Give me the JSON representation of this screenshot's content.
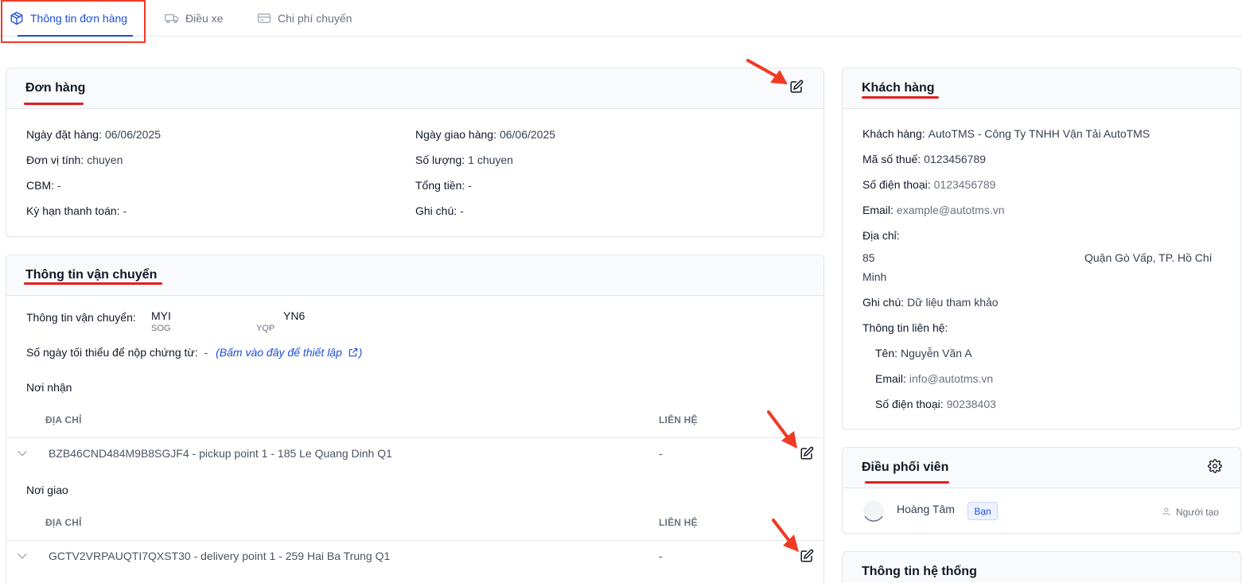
{
  "tabs": [
    {
      "label": "Thông tin đơn hàng",
      "icon": "box-icon",
      "active": true
    },
    {
      "label": "Điều xe",
      "icon": "truck-icon",
      "active": false
    },
    {
      "label": "Chi phí chuyến",
      "icon": "card-icon",
      "active": false
    }
  ],
  "order": {
    "title": "Đơn hàng",
    "order_date_label": "Ngày đặt hàng:",
    "order_date": "06/06/2025",
    "delivery_date_label": "Ngày giao hàng:",
    "delivery_date": "06/06/2025",
    "unit_label": "Đơn vị tính:",
    "unit": "chuyen",
    "quantity_label": "Số lượng:",
    "quantity": "1 chuyen",
    "cbm_label": "CBM:",
    "cbm": "-",
    "total_label": "Tổng tiền:",
    "total": "-",
    "payment_term_label": "Kỳ hạn thanh toán:",
    "payment_term": "-",
    "note_label": "Ghi chú:",
    "note": "-"
  },
  "shipping": {
    "title": "Thông tin vận chuyển",
    "info_label": "Thông tin vận chuyển:",
    "route_from_code": "MYI",
    "route_from_sub": "SOG",
    "route_to_code": "YN6",
    "route_to_sub": "YQP",
    "min_days_label": "Số ngày tối thiểu để nộp chứng từ:",
    "min_days_value": "-",
    "setup_link": "(Bấm vào đây để thiết lập",
    "setup_link_close": ")",
    "pickup_section": "Nơi nhận",
    "delivery_section": "Nơi giao",
    "col_address": "ĐỊA CHỈ",
    "col_contact": "LIÊN HỆ",
    "pickup_row": {
      "address": "BZB46CND484M9B8SGJF4 - pickup point 1 - 185 Le Quang Dinh Q1",
      "contact": "-"
    },
    "delivery_row": {
      "address": "GCTV2VRPAUQTI7QXST30 - delivery point 1 - 259 Hai Ba Trung Q1",
      "contact": "-"
    }
  },
  "customer": {
    "title": "Khách hàng",
    "name_label": "Khách hàng:",
    "name": "AutoTMS - Công Ty TNHH Vận Tải AutoTMS",
    "tax_label": "Mã số thuế:",
    "tax": "0123456789",
    "phone_label": "Số điện thoại:",
    "phone": "0123456789",
    "email_label": "Email:",
    "email": "example@autotms.vn",
    "address_label": "Địa chỉ:",
    "address_line1_left": "85",
    "address_line1_right": "Quận Gò Vấp, TP. Hồ Chí",
    "address_line2": "Minh",
    "note_label": "Ghi chú:",
    "note": "Dữ liệu tham khảo",
    "contact_label": "Thông tin liên hệ:",
    "contact_name_label": "Tên:",
    "contact_name": "Nguyễn Văn A",
    "contact_email_label": "Email:",
    "contact_email": "info@autotms.vn",
    "contact_phone_label": "Số điện thoại:",
    "contact_phone": "90238403"
  },
  "dispatcher": {
    "title": "Điều phối viên",
    "name": "Hoàng Tâm",
    "badge": "Bạn",
    "role": "Người tạo"
  },
  "system": {
    "title": "Thông tin hệ thống"
  },
  "colors": {
    "accent": "#1d4ed8",
    "annotation_red": "#ef3b24"
  }
}
